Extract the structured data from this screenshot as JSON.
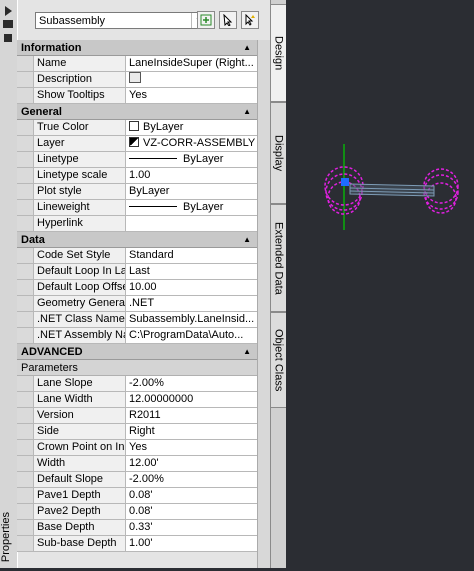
{
  "sidebar": {
    "label": "Properties"
  },
  "toolbar": {
    "selected_object": "Subassembly"
  },
  "tabs": [
    "Design",
    "Display",
    "Extended Data",
    "Object Class"
  ],
  "sections": {
    "information": {
      "title": "Information",
      "rows": [
        {
          "name": "Name",
          "value": "LaneInsideSuper (Right..."
        },
        {
          "name": "Description",
          "value": ""
        },
        {
          "name": "Show Tooltips",
          "value": "Yes"
        }
      ]
    },
    "general": {
      "title": "General",
      "rows": [
        {
          "name": "True Color",
          "value": "ByLayer"
        },
        {
          "name": "Layer",
          "value": "VZ-CORR-ASSEMBLY"
        },
        {
          "name": "Linetype",
          "value": "ByLayer"
        },
        {
          "name": "Linetype scale",
          "value": "1.00"
        },
        {
          "name": "Plot style",
          "value": "ByLayer"
        },
        {
          "name": "Lineweight",
          "value": "ByLayer"
        },
        {
          "name": "Hyperlink",
          "value": ""
        }
      ]
    },
    "data": {
      "title": "Data",
      "rows": [
        {
          "name": "Code Set Style",
          "value": "Standard"
        },
        {
          "name": "Default Loop In La...",
          "value": "Last"
        },
        {
          "name": "Default Loop Offse...",
          "value": "10.00"
        },
        {
          "name": "Geometry Generat...",
          "value": ".NET"
        },
        {
          "name": ".NET Class Name",
          "value": "Subassembly.LaneInsid..."
        },
        {
          "name": ".NET Assembly Na...",
          "value": "C:\\ProgramData\\Auto..."
        }
      ]
    },
    "advanced": {
      "title": "ADVANCED",
      "subtitle": "Parameters",
      "rows": [
        {
          "name": "Lane Slope",
          "value": "-2.00%"
        },
        {
          "name": "Lane Width",
          "value": "12.00000000"
        },
        {
          "name": "Version",
          "value": "R2011"
        },
        {
          "name": "Side",
          "value": "Right"
        },
        {
          "name": "Crown Point on In...",
          "value": "Yes"
        },
        {
          "name": "Width",
          "value": "12.00'"
        },
        {
          "name": "Default Slope",
          "value": "-2.00%"
        },
        {
          "name": "Pave1 Depth",
          "value": "0.08'"
        },
        {
          "name": "Pave2 Depth",
          "value": "0.08'"
        },
        {
          "name": "Base Depth",
          "value": "0.33'"
        },
        {
          "name": "Sub-base Depth",
          "value": "1.00'"
        }
      ]
    }
  },
  "colors": {
    "canvas": "#2b2d33",
    "magenta": "#e020e0",
    "green": "#00d000",
    "blue": "#1e6cff"
  }
}
